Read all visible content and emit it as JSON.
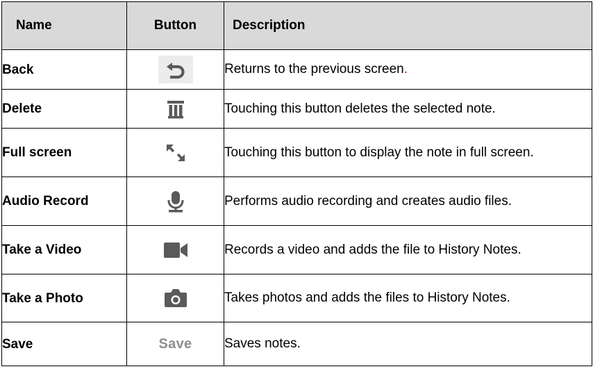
{
  "header": {
    "name": "Name",
    "button": "Button",
    "description": "Description"
  },
  "rows": [
    {
      "name": "Back",
      "icon": "back-arrow-icon",
      "description": "Returns to the previous screen",
      "description_suffix": "."
    },
    {
      "name": "Delete",
      "icon": "trash-icon",
      "description": "Touching this button deletes the selected note."
    },
    {
      "name": "Full screen",
      "icon": "expand-icon",
      "description": "Touching this button to display the note in full screen."
    },
    {
      "name": "Audio Record",
      "icon": "microphone-icon",
      "description": "Performs audio recording and creates audio files."
    },
    {
      "name": "Take a Video",
      "icon": "video-camera-icon",
      "description": "Records a video and adds the file to History Notes."
    },
    {
      "name": "Take a Photo",
      "icon": "photo-camera-icon",
      "description": "Takes photos and adds the files to History Notes."
    },
    {
      "name": "Save",
      "button_label": "Save",
      "description": "Saves notes."
    }
  ],
  "colors": {
    "header_bg": "#d9d9d9",
    "icon_gray": "#5a5a5a",
    "save_gray": "#8e8e8e",
    "accent_red": "#d0021b"
  }
}
